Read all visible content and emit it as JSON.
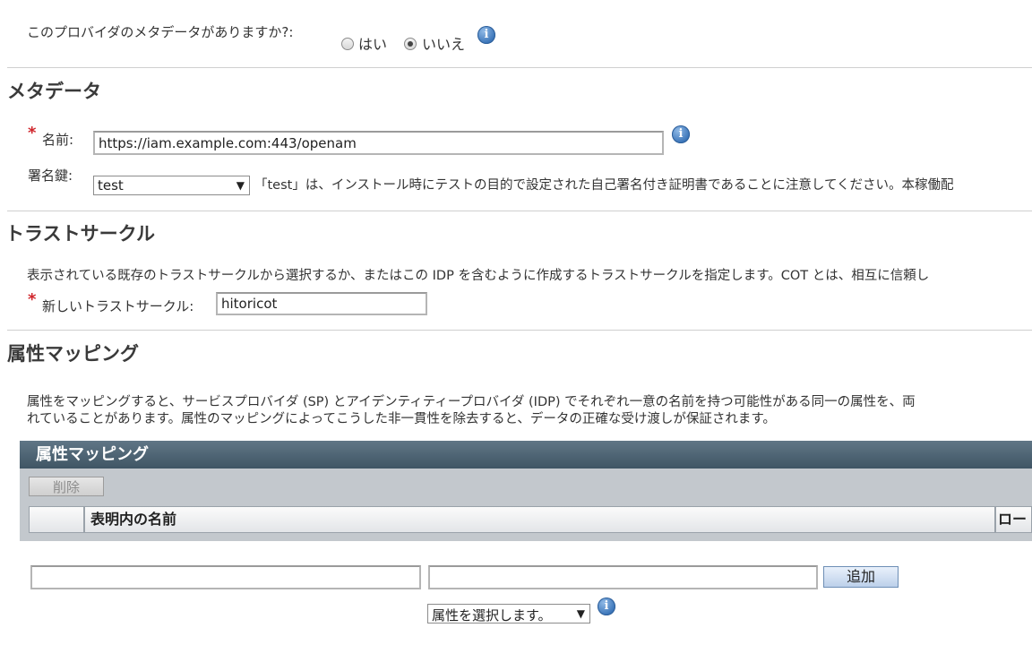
{
  "metadata_question": {
    "label": "このプロバイダのメタデータがありますか?:",
    "options": [
      "はい",
      "いいえ"
    ],
    "selected": "いいえ",
    "info_icon": "info-icon"
  },
  "metadata_section": {
    "title": "メタデータ",
    "name_label": "名前:",
    "name_value": "https://iam.example.com:443/openam",
    "signing_key_label": "署名鍵:",
    "signing_key_value": "test",
    "signing_key_note": "「test」は、インストール時にテストの目的で設定された自己署名付き証明書であることに注意してください。本稼働配"
  },
  "cot_section": {
    "title": "トラストサークル",
    "description": "表示されている既存のトラストサークルから選択するか、またはこの IDP を含むように作成するトラストサークルを指定します。COT とは、相互に信頼し",
    "new_cot_label": "新しいトラストサークル:",
    "new_cot_value": "hitoricot"
  },
  "attr_section": {
    "title": "属性マッピング",
    "description_line1": "属性をマッピングすると、サービスプロバイダ (SP) とアイデンティティープロバイダ (IDP) でそれぞれ一意の名前を持つ可能性がある同一の属性を、両",
    "description_line2": "れていることがあります。属性のマッピングによってこうした非一貫性を除去すると、データの正確な受け渡しが保証されます。",
    "table_title": "属性マッピング",
    "delete_button": "削除",
    "col_name_in_assertion": "表明内の名前",
    "col_local": "ローカ",
    "add_button": "追加",
    "attribute_select": "属性を選択します。"
  },
  "required_marker": "*",
  "colors": {
    "required": "#d0262c",
    "table_header": "#4a5f6e",
    "info_icon": "#3a74b8"
  }
}
